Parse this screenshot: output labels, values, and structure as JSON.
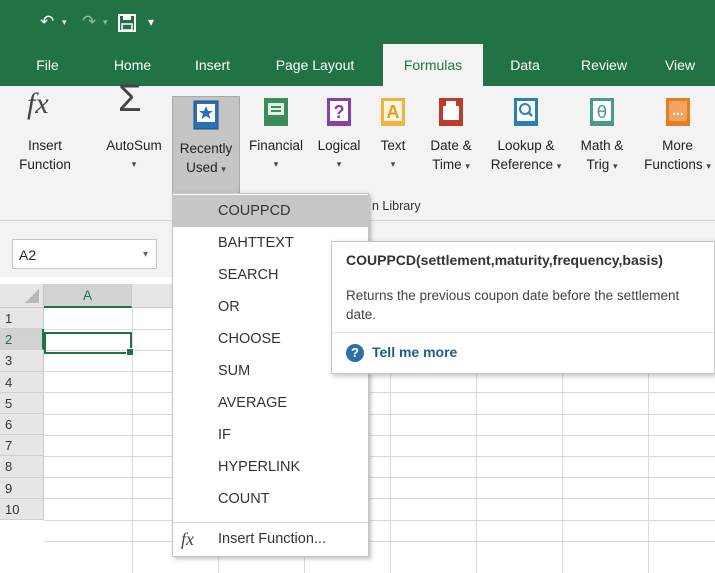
{
  "quick_access": {
    "undo_icon": "undo-icon",
    "redo_icon": "redo-icon",
    "save_icon": "save-icon",
    "customize_icon": "customize-qat-icon"
  },
  "tabs": [
    {
      "label": "File"
    },
    {
      "label": "Home"
    },
    {
      "label": "Insert"
    },
    {
      "label": "Page Layout"
    },
    {
      "label": "Formulas",
      "active": true
    },
    {
      "label": "Data"
    },
    {
      "label": "Review"
    },
    {
      "label": "View"
    }
  ],
  "ribbon": {
    "insert_function": {
      "line1": "Insert",
      "line2": "Function"
    },
    "autosum": {
      "line1": "AutoSum"
    },
    "recently_used": {
      "line1": "Recently",
      "line2": "Used"
    },
    "financial": {
      "line1": "Financial"
    },
    "logical": {
      "line1": "Logical"
    },
    "text": {
      "line1": "Text"
    },
    "date_time": {
      "line1": "Date &",
      "line2": "Time"
    },
    "lookup": {
      "line1": "Lookup &",
      "line2": "Reference"
    },
    "math": {
      "line1": "Math &",
      "line2": "Trig"
    },
    "more": {
      "line1": "More",
      "line2": "Functions"
    },
    "group_label": "n Library"
  },
  "formula_bar": {
    "name_box": "A2"
  },
  "grid": {
    "columns": [
      "A",
      ""
    ],
    "rows": [
      "1",
      "2",
      "3",
      "4",
      "5",
      "6",
      "7",
      "8",
      "9",
      "10"
    ],
    "selected_cell": "A2"
  },
  "recently_used_menu": {
    "items": [
      "COUPPCD",
      "BAHTTEXT",
      "SEARCH",
      "OR",
      "CHOOSE",
      "SUM",
      "AVERAGE",
      "IF",
      "HYPERLINK",
      "COUNT"
    ],
    "highlighted": "COUPPCD",
    "insert_function_label": "Insert Function..."
  },
  "tooltip": {
    "title": "COUPPCD(settlement,maturity,frequency,basis)",
    "description": "Returns the previous coupon date before the settlement date.",
    "link": "Tell me more"
  },
  "colors": {
    "excel_green": "#217346",
    "ribbon_bg": "#f3f3f3",
    "highlight": "#c6c6c6"
  }
}
